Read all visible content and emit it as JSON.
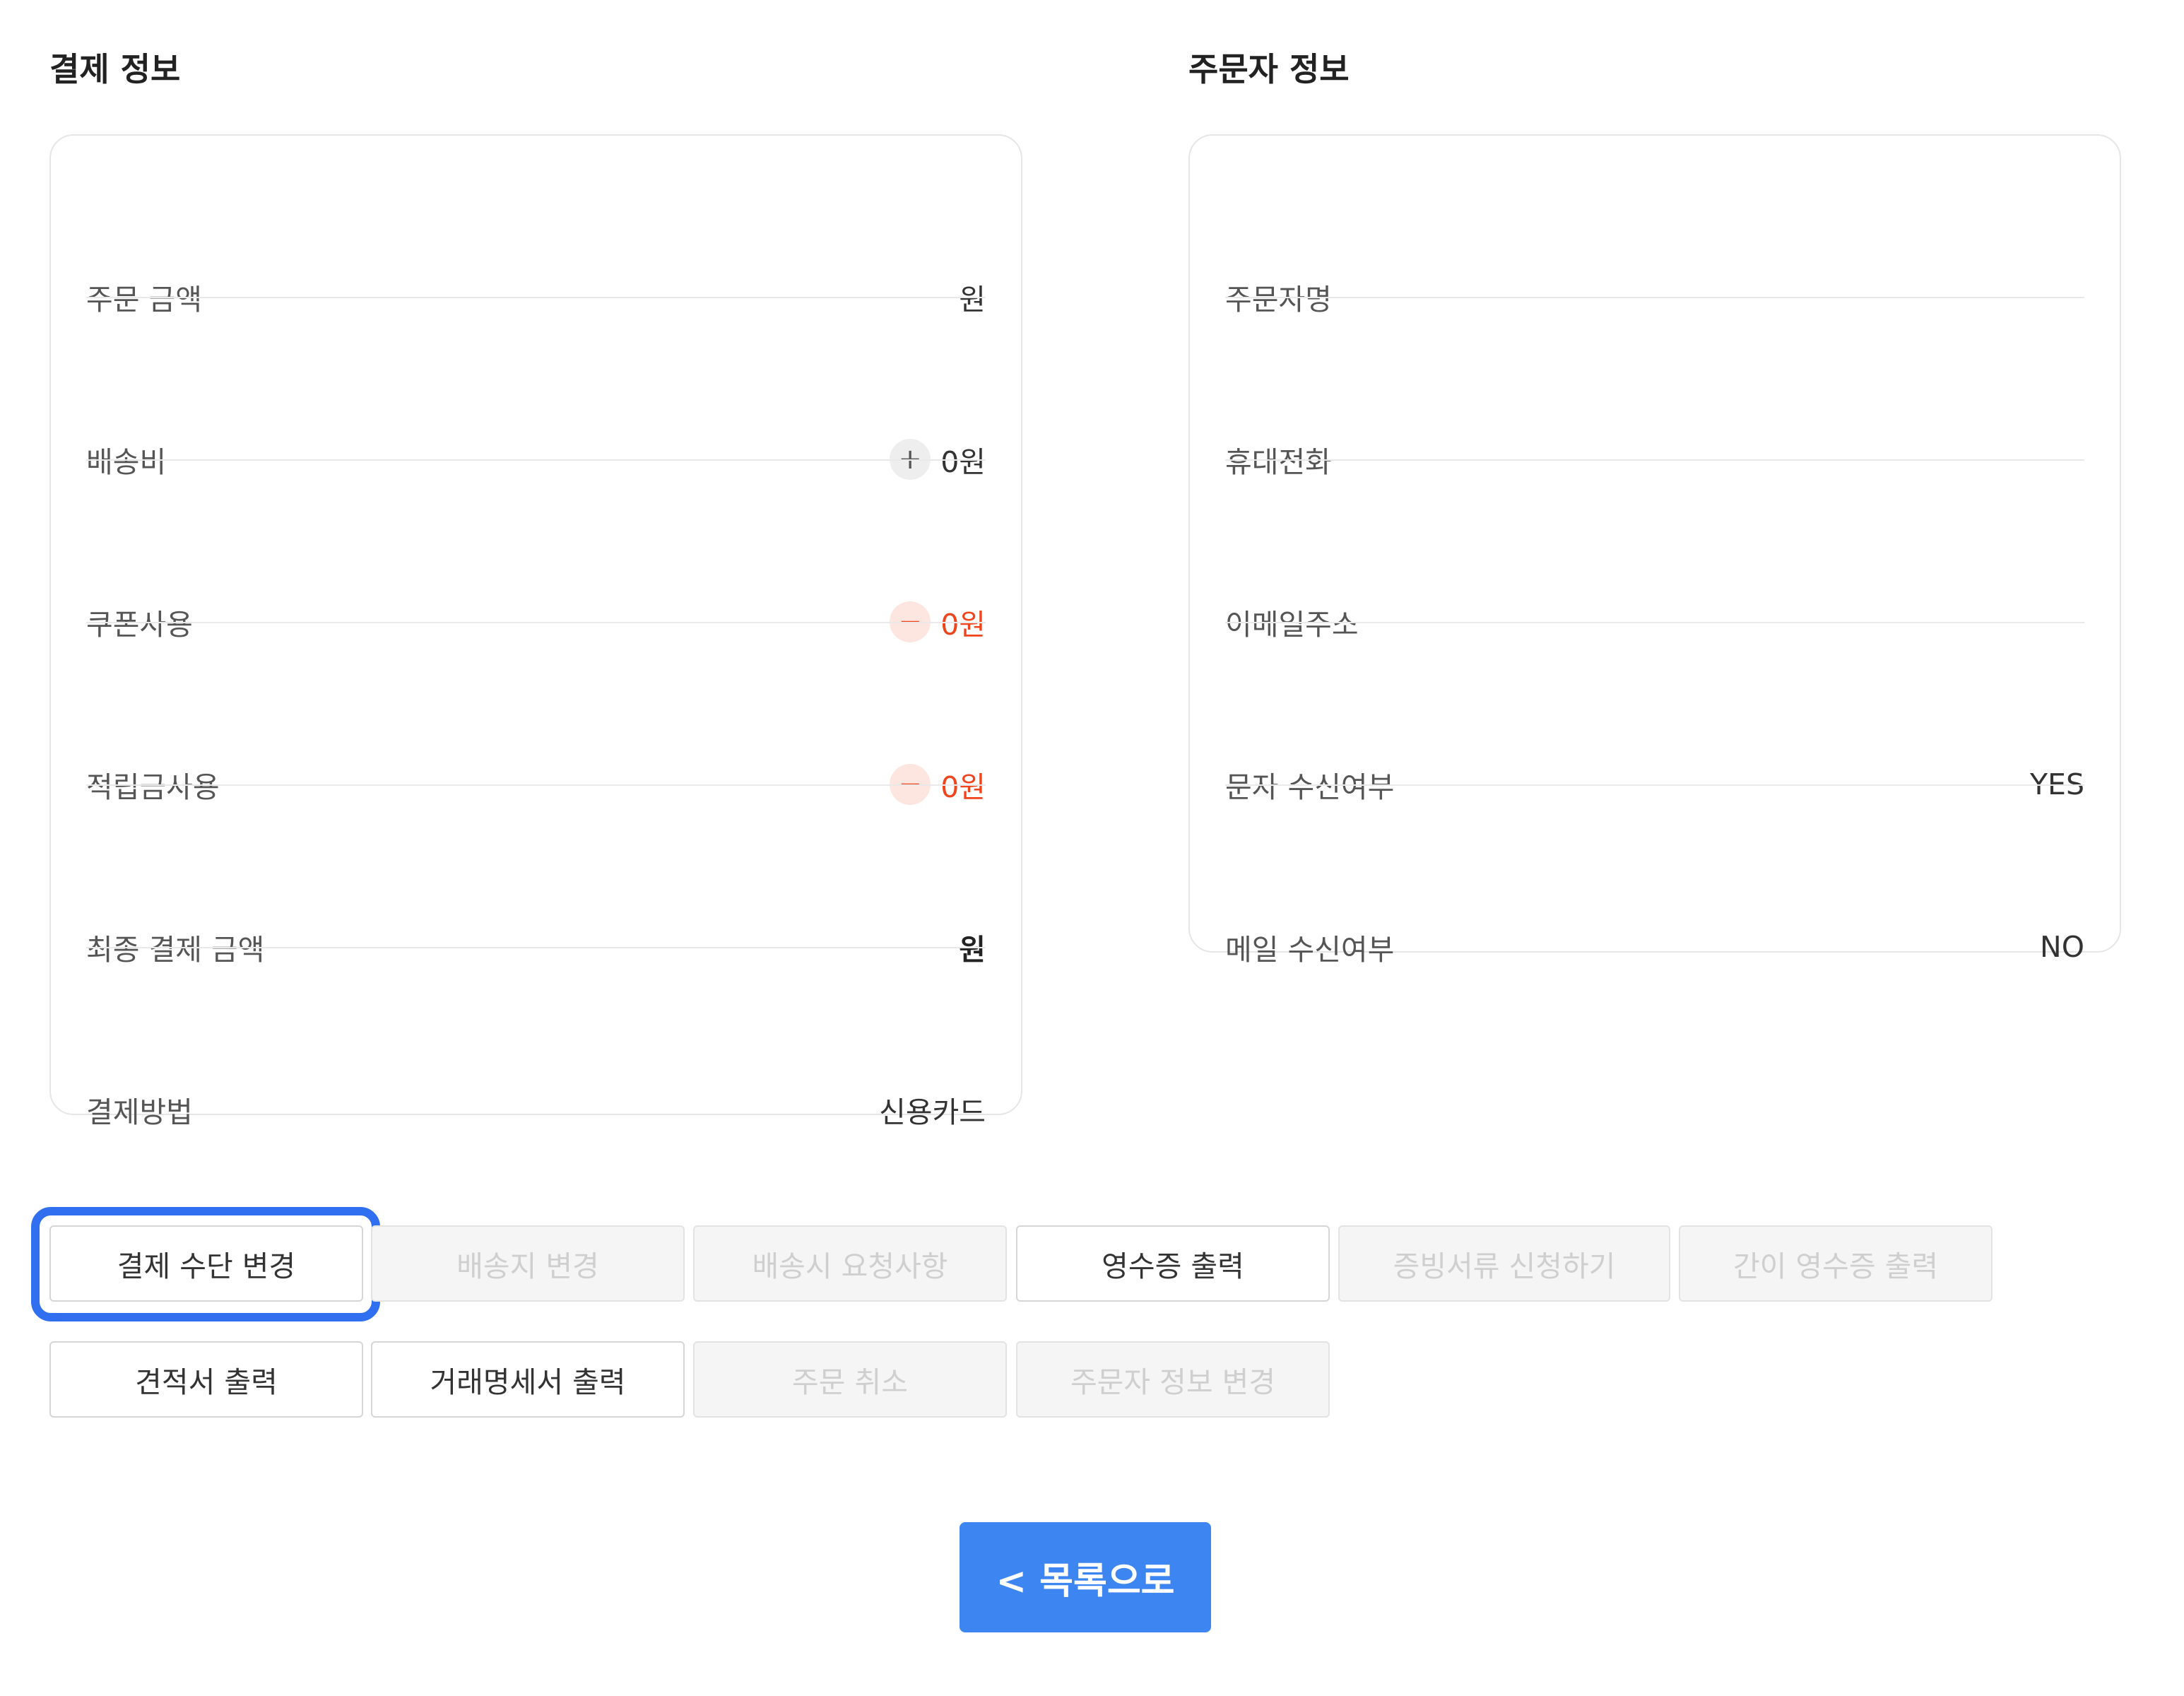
{
  "payment": {
    "title": "결제 정보",
    "rows": [
      {
        "label": "주문 금액",
        "value": "원"
      },
      {
        "label": "배송비",
        "sign": "+",
        "value": "0원"
      },
      {
        "label": "쿠폰사용",
        "sign": "−",
        "value": "0원"
      },
      {
        "label": "적립금사용",
        "sign": "−",
        "value": "0원"
      },
      {
        "label": "최종 결제 금액",
        "value": "원"
      },
      {
        "label": "결제방법",
        "value": "신용카드"
      }
    ]
  },
  "orderer": {
    "title": "주문자 정보",
    "rows": [
      {
        "label": "주문자명",
        "value": ""
      },
      {
        "label": "휴대전화",
        "value": ""
      },
      {
        "label": "이메일주소",
        "value": ""
      },
      {
        "label": "문자 수신여부",
        "value": "YES"
      },
      {
        "label": "메일 수신여부",
        "value": "NO"
      }
    ]
  },
  "actions": {
    "row1": [
      {
        "label": "결제 수단 변경",
        "enabled": true
      },
      {
        "label": "배송지 변경",
        "enabled": false
      },
      {
        "label": "배송시 요청사항",
        "enabled": false
      },
      {
        "label": "영수증 출력",
        "enabled": true
      },
      {
        "label": "증빙서류 신청하기",
        "enabled": false
      },
      {
        "label": "간이 영수증 출력",
        "enabled": false
      }
    ],
    "row2": [
      {
        "label": "견적서 출력",
        "enabled": true
      },
      {
        "label": "거래명세서 출력",
        "enabled": true
      },
      {
        "label": "주문 취소",
        "enabled": false
      },
      {
        "label": "주문자 정보 변경",
        "enabled": false
      }
    ]
  },
  "back_button": {
    "label": "< 목록으로"
  },
  "colors": {
    "accent": "#3d86f2",
    "focus": "#2f6ff0",
    "discount": "#f0441c",
    "disabled_text": "#cfcfcf"
  }
}
